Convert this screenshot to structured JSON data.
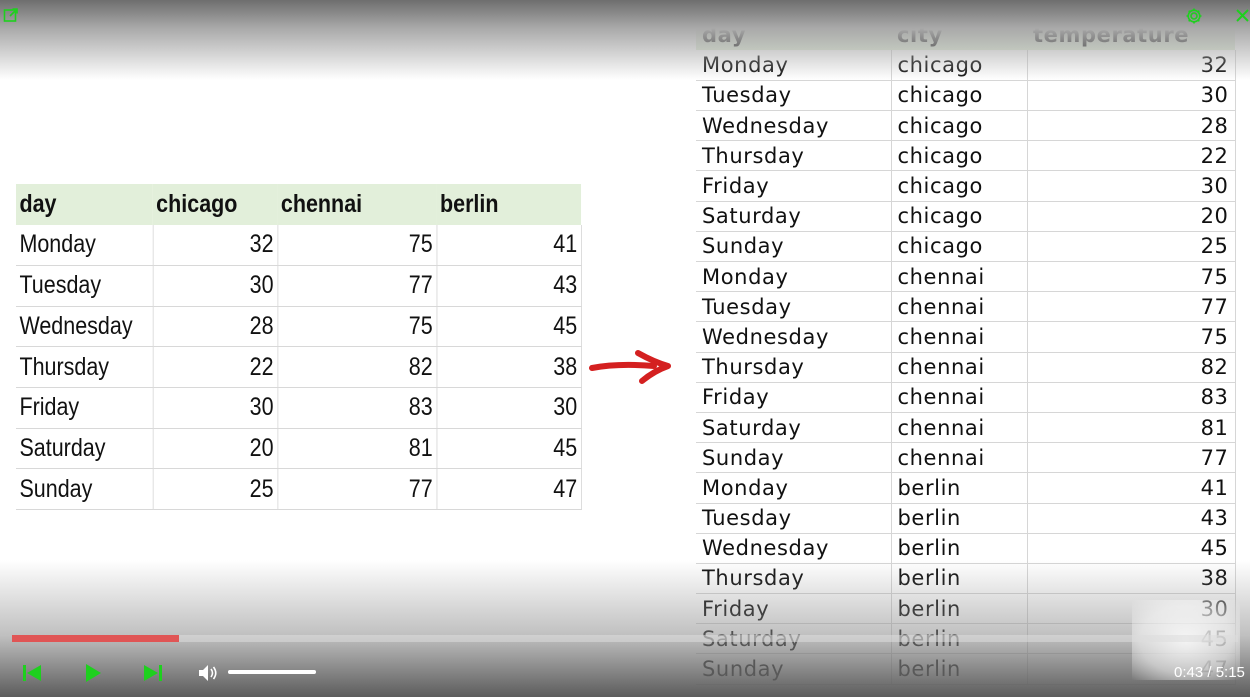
{
  "wide_table": {
    "headers": [
      "day",
      "chicago",
      "chennai",
      "berlin"
    ],
    "rows": [
      [
        "Monday",
        "32",
        "75",
        "41"
      ],
      [
        "Tuesday",
        "30",
        "77",
        "43"
      ],
      [
        "Wednesday",
        "28",
        "75",
        "45"
      ],
      [
        "Thursday",
        "22",
        "82",
        "38"
      ],
      [
        "Friday",
        "30",
        "83",
        "30"
      ],
      [
        "Saturday",
        "20",
        "81",
        "45"
      ],
      [
        "Sunday",
        "25",
        "77",
        "47"
      ]
    ]
  },
  "long_table": {
    "headers": [
      "day",
      "city",
      "temperature"
    ],
    "rows": [
      [
        "Monday",
        "chicago",
        "32"
      ],
      [
        "Tuesday",
        "chicago",
        "30"
      ],
      [
        "Wednesday",
        "chicago",
        "28"
      ],
      [
        "Thursday",
        "chicago",
        "22"
      ],
      [
        "Friday",
        "chicago",
        "30"
      ],
      [
        "Saturday",
        "chicago",
        "20"
      ],
      [
        "Sunday",
        "chicago",
        "25"
      ],
      [
        "Monday",
        "chennai",
        "75"
      ],
      [
        "Tuesday",
        "chennai",
        "77"
      ],
      [
        "Wednesday",
        "chennai",
        "75"
      ],
      [
        "Thursday",
        "chennai",
        "82"
      ],
      [
        "Friday",
        "chennai",
        "83"
      ],
      [
        "Saturday",
        "chennai",
        "81"
      ],
      [
        "Sunday",
        "chennai",
        "77"
      ],
      [
        "Monday",
        "berlin",
        "41"
      ],
      [
        "Tuesday",
        "berlin",
        "43"
      ],
      [
        "Wednesday",
        "berlin",
        "45"
      ],
      [
        "Thursday",
        "berlin",
        "38"
      ],
      [
        "Friday",
        "berlin",
        "30"
      ],
      [
        "Saturday",
        "berlin",
        "45"
      ],
      [
        "Sunday",
        "berlin",
        "47"
      ]
    ]
  },
  "player": {
    "time_display": "0:43 / 5:15",
    "progress_fraction": 0.1365,
    "volume_fraction": 1.0
  },
  "colors": {
    "accent_green": "#1ed01e",
    "header_fill": "#e2efda",
    "progress_red": "#e05555",
    "arrow_red": "#d42020"
  },
  "icons": {
    "top_left": "popout-icon",
    "top_right_1": "gear-icon",
    "top_right_2": "close-icon",
    "controls": [
      "skip-previous-icon",
      "play-icon",
      "skip-next-icon",
      "volume-icon"
    ],
    "center": "arrow-icon"
  }
}
